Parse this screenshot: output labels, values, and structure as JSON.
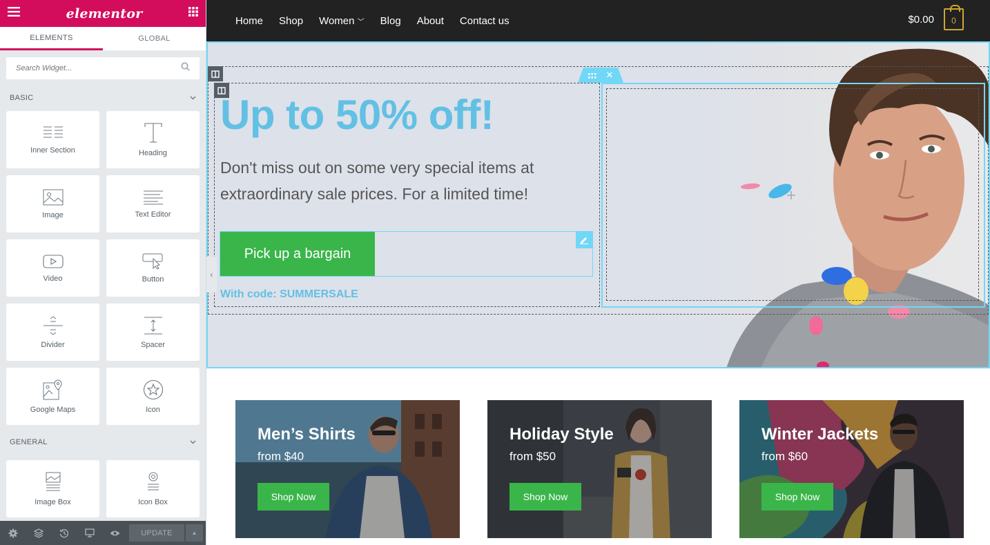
{
  "panel": {
    "logo": "elementor",
    "tabs": [
      "ELEMENTS",
      "GLOBAL"
    ],
    "search_placeholder": "Search Widget...",
    "categories": {
      "basic": "BASIC",
      "general": "GENERAL"
    },
    "basic_widgets": [
      {
        "label": "Inner Section",
        "icon": "inner-section-icon"
      },
      {
        "label": "Heading",
        "icon": "heading-icon"
      },
      {
        "label": "Image",
        "icon": "image-icon"
      },
      {
        "label": "Text Editor",
        "icon": "text-editor-icon"
      },
      {
        "label": "Video",
        "icon": "video-icon"
      },
      {
        "label": "Button",
        "icon": "button-icon"
      },
      {
        "label": "Divider",
        "icon": "divider-icon"
      },
      {
        "label": "Spacer",
        "icon": "spacer-icon"
      },
      {
        "label": "Google Maps",
        "icon": "google-maps-icon"
      },
      {
        "label": "Icon",
        "icon": "star-icon"
      }
    ],
    "general_widgets": [
      {
        "label": "Image Box",
        "icon": "image-box-icon"
      },
      {
        "label": "Icon Box",
        "icon": "icon-box-icon"
      }
    ],
    "footer": {
      "update_label": "UPDATE"
    },
    "accent": "#d30c5c"
  },
  "site": {
    "nav": [
      "Home",
      "Shop",
      "Women",
      "Blog",
      "About",
      "Contact us"
    ],
    "cart_total": "$0.00",
    "cart_count": "0",
    "hero": {
      "headline": "Up to 50% off!",
      "subtext": "Don't miss out on some very special items at extraordinary sale prices. For a limited time!",
      "button": "Pick up a bargain",
      "code": "With code: SUMMERSALE"
    },
    "cards": [
      {
        "title": "Men’s Shirts",
        "price": "from $40",
        "button": "Shop Now"
      },
      {
        "title": "Holiday Style",
        "price": "from $50",
        "button": "Shop Now"
      },
      {
        "title": "Winter Jackets",
        "price": "from $60",
        "button": "Shop Now"
      }
    ],
    "colors": {
      "green": "#3ab54a",
      "blue": "#62c0e4",
      "selection": "#71d7f7",
      "nav_bg": "#222222"
    }
  }
}
